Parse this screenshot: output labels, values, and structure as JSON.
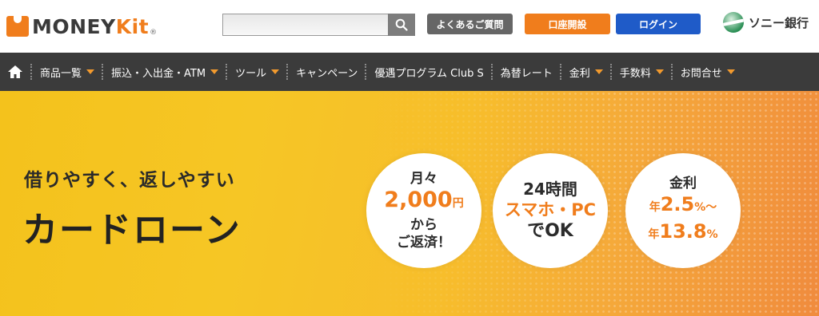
{
  "header": {
    "logo_main": "MONEY",
    "logo_kit": "Kit",
    "logo_reg": "®",
    "search": {
      "placeholder": ""
    },
    "faq_label": "よくあるご質問",
    "open_account_label": "口座開設",
    "login_label": "ログイン",
    "bank_name": "ソニー銀行"
  },
  "nav": {
    "items": [
      {
        "label": "商品一覧",
        "has_dropdown": true
      },
      {
        "label": "振込・入出金・ATM",
        "has_dropdown": true
      },
      {
        "label": "ツール",
        "has_dropdown": true
      },
      {
        "label": "キャンペーン",
        "has_dropdown": false
      },
      {
        "label": "優遇プログラム Club S",
        "has_dropdown": false
      },
      {
        "label": "為替レート",
        "has_dropdown": false
      },
      {
        "label": "金利",
        "has_dropdown": true
      },
      {
        "label": "手数料",
        "has_dropdown": true
      },
      {
        "label": "お問合せ",
        "has_dropdown": true
      }
    ]
  },
  "hero": {
    "subtitle": "借りやすく、返しやすい",
    "title": "カードローン",
    "circle1": {
      "line1": "月々",
      "amount": "2,000",
      "unit": "円",
      "line3": "から",
      "line4": "ご返済！"
    },
    "circle2": {
      "line1": "24時間",
      "line2": "スマホ・PC",
      "line3": "でOK"
    },
    "circle3": {
      "line1": "金利",
      "prefix1": "年",
      "rate_min": "2.5",
      "pct1": "%〜",
      "prefix2": "年",
      "rate_max": "13.8",
      "pct2": "%"
    }
  },
  "colors": {
    "accent_orange": "#f07d1c",
    "login_blue": "#1f5bc8",
    "nav_bg": "#3b3b3b",
    "hero_yellow": "#f6c625"
  }
}
